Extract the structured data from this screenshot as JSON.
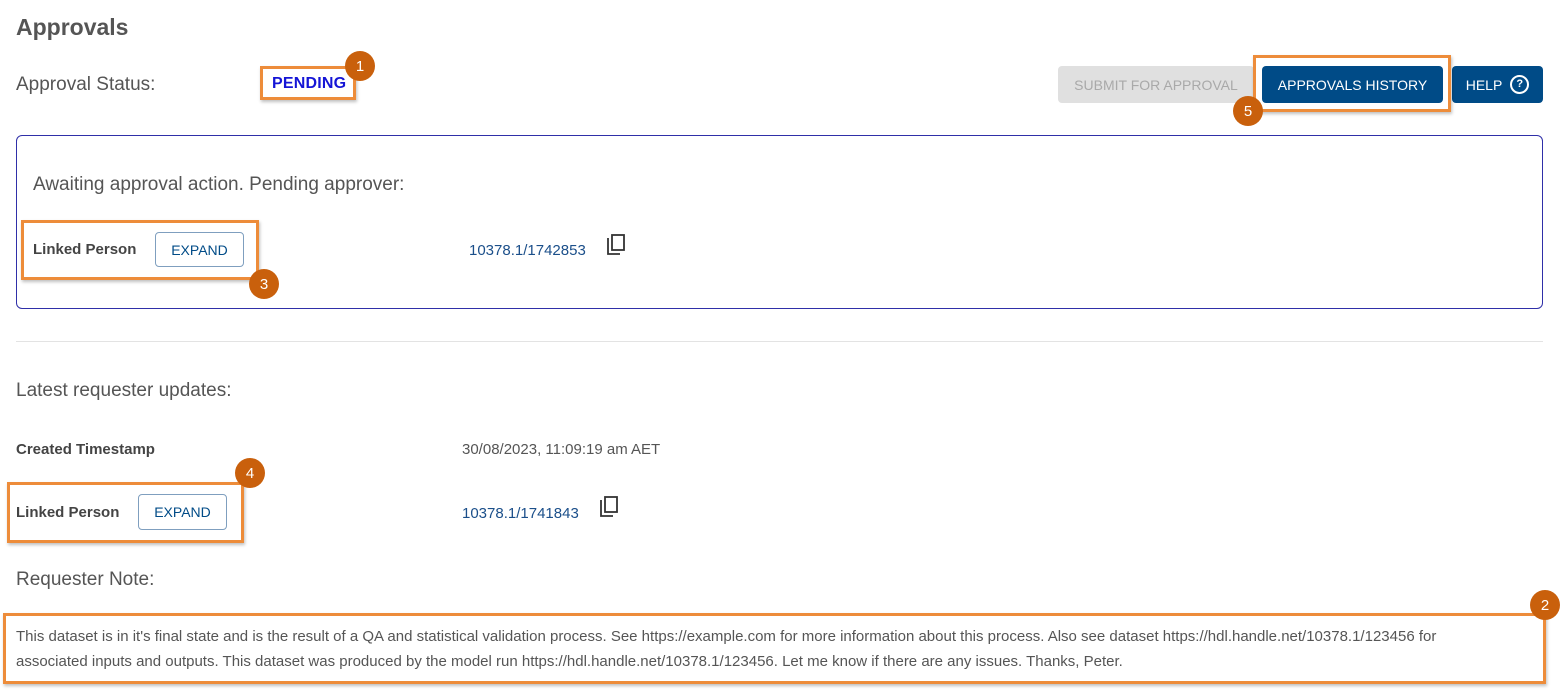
{
  "page": {
    "title": "Approvals",
    "status_label": "Approval Status:",
    "status_value": "PENDING"
  },
  "actions": {
    "submit_label": "SUBMIT FOR APPROVAL",
    "history_label": "APPROVALS HISTORY",
    "help_label": "HELP",
    "help_icon": "?"
  },
  "pending": {
    "heading": "Awaiting approval action. Pending approver:",
    "linked_person_label": "Linked Person",
    "expand_label": "EXPAND",
    "handle": "10378.1/1742853"
  },
  "requester": {
    "heading": "Latest requester updates:",
    "created_label": "Created Timestamp",
    "created_value": "30/08/2023, 11:09:19 am AET",
    "linked_person_label": "Linked Person",
    "expand_label": "EXPAND",
    "handle": "10378.1/1741843",
    "note_label": "Requester Note:",
    "note_line1": "This dataset is in it's final state and is the result of a QA and statistical validation process. See https://example.com for more information about this process. Also see dataset https://hdl.handle.net/10378.1/123456 for",
    "note_line2": "associated inputs and outputs. This dataset was produced by the model run https://hdl.handle.net/10378.1/123456. Let me know if there are any issues. Thanks, Peter."
  },
  "annotations": {
    "m1": "1",
    "m2": "2",
    "m3": "3",
    "m4": "4",
    "m5": "5"
  },
  "colors": {
    "primary": "#004b87",
    "status": "#1515d6",
    "highlight": "#ed8c3a",
    "marker": "#c9600c"
  },
  "icons": {
    "copy": "copy-icon",
    "help": "help-circle-icon"
  }
}
